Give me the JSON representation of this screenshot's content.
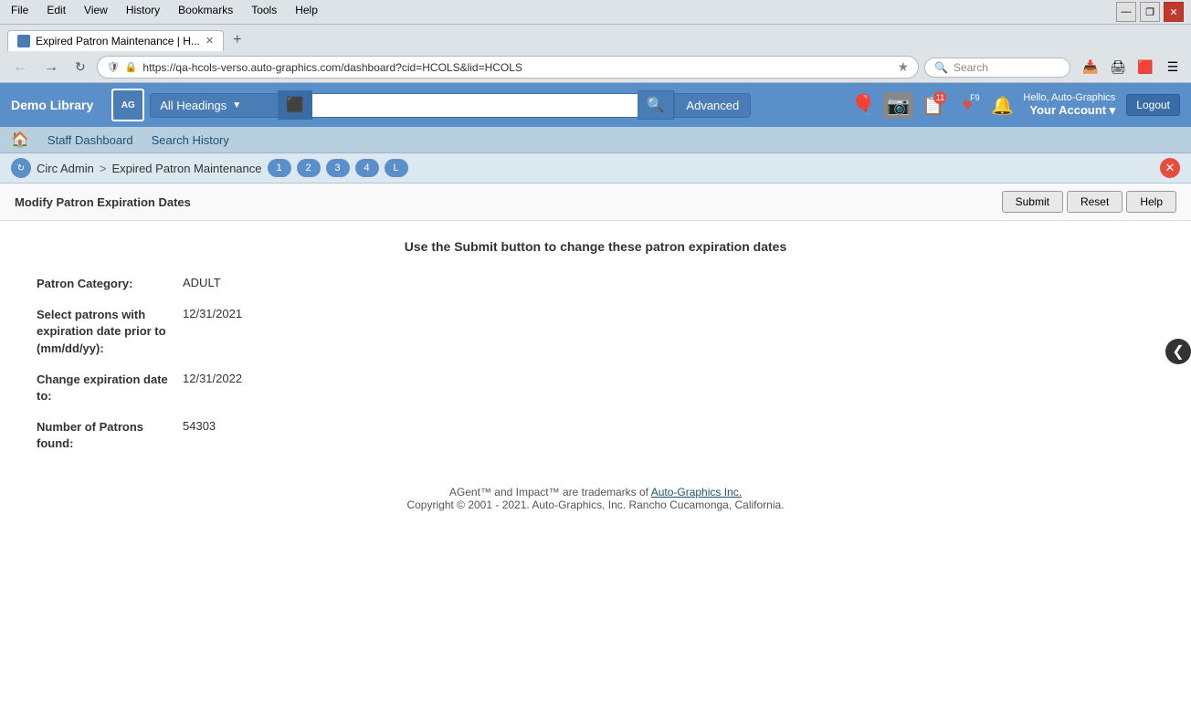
{
  "browser": {
    "menu_items": [
      "File",
      "Edit",
      "View",
      "History",
      "Bookmarks",
      "Tools",
      "Help"
    ],
    "tab_title": "Expired Patron Maintenance | H...",
    "url": "https://qa-hcols-verso.auto-graphics.com/dashboard?cid=HCOLS&lid=HCOLS",
    "new_tab_label": "+",
    "search_placeholder": "Search",
    "win_minimize": "—",
    "win_restore": "❐",
    "win_close": "✕"
  },
  "header": {
    "library_name": "Demo Library",
    "search_type": "All Headings",
    "search_placeholder": "",
    "advanced_label": "Advanced",
    "notifications_count": "11",
    "favorites_count": "F9",
    "hello_text": "Hello, Auto-Graphics",
    "account_label": "Your Account",
    "logout_label": "Logout"
  },
  "secondary_nav": {
    "staff_dashboard": "Staff Dashboard",
    "search_history": "Search History"
  },
  "breadcrumb": {
    "circ_admin": "Circ Admin",
    "separator": ">",
    "page_title": "Expired Patron Maintenance",
    "steps": [
      "1",
      "2",
      "3",
      "4",
      "L"
    ]
  },
  "form": {
    "title": "Modify Patron Expiration Dates",
    "instruction": "Use the Submit button to change these patron expiration dates",
    "submit_label": "Submit",
    "reset_label": "Reset",
    "help_label": "Help",
    "fields": [
      {
        "label": "Patron Category:",
        "value": "ADULT"
      },
      {
        "label": "Select patrons with expiration date prior to (mm/dd/yy):",
        "value": "12/31/2021"
      },
      {
        "label": "Change expiration date to:",
        "value": "12/31/2022"
      },
      {
        "label": "Number of Patrons found:",
        "value": "54303"
      }
    ]
  },
  "footer": {
    "trademark_text": "AGent™ and Impact™ are trademarks of ",
    "company_link": "Auto-Graphics Inc.",
    "company_url": "#",
    "copyright": "Copyright © 2001 - 2021. Auto-Graphics, Inc. Rancho Cucamonga, California."
  }
}
